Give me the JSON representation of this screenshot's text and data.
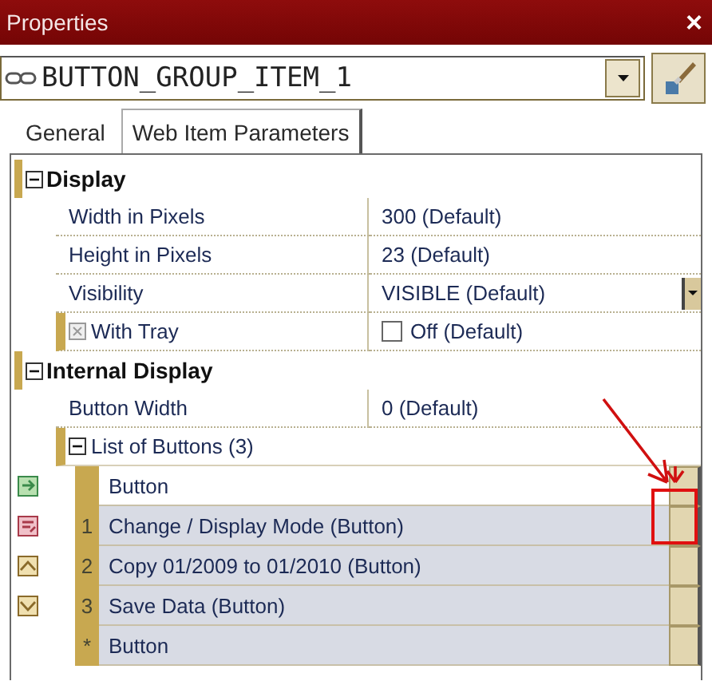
{
  "window": {
    "title": "Properties",
    "close": "×"
  },
  "object_selector": {
    "value": "BUTTON_GROUP_ITEM_1"
  },
  "tabs": [
    {
      "label": "General",
      "selected": false
    },
    {
      "label": "Web Item Parameters",
      "selected": true
    }
  ],
  "sections": [
    {
      "title": "Display",
      "expanded": true,
      "properties": [
        {
          "kind": "text",
          "name": "Width in Pixels",
          "value": "300 (Default)"
        },
        {
          "kind": "text",
          "name": "Height in Pixels",
          "value": "23 (Default)"
        },
        {
          "kind": "dropdown",
          "name": "Visibility",
          "value": "VISIBLE (Default)"
        },
        {
          "kind": "checkbox",
          "name": "With Tray",
          "value": "Off (Default)",
          "checked": false
        }
      ]
    },
    {
      "title": "Internal Display",
      "expanded": true,
      "properties": [
        {
          "kind": "text",
          "name": "Button Width",
          "value": "0 (Default)"
        },
        {
          "kind": "list",
          "name": "List of Buttons (3)",
          "expanded": true,
          "rows": [
            {
              "kind": "header",
              "label": "Button"
            },
            {
              "kind": "item",
              "index": "1",
              "label": "Change / Display Mode (Button)"
            },
            {
              "kind": "item",
              "index": "2",
              "label": "Copy 01/2009 to 01/2010 (Button)"
            },
            {
              "kind": "item",
              "index": "3",
              "label": "Save Data (Button)"
            },
            {
              "kind": "new",
              "index": "*",
              "label": "Button"
            }
          ]
        }
      ]
    }
  ]
}
